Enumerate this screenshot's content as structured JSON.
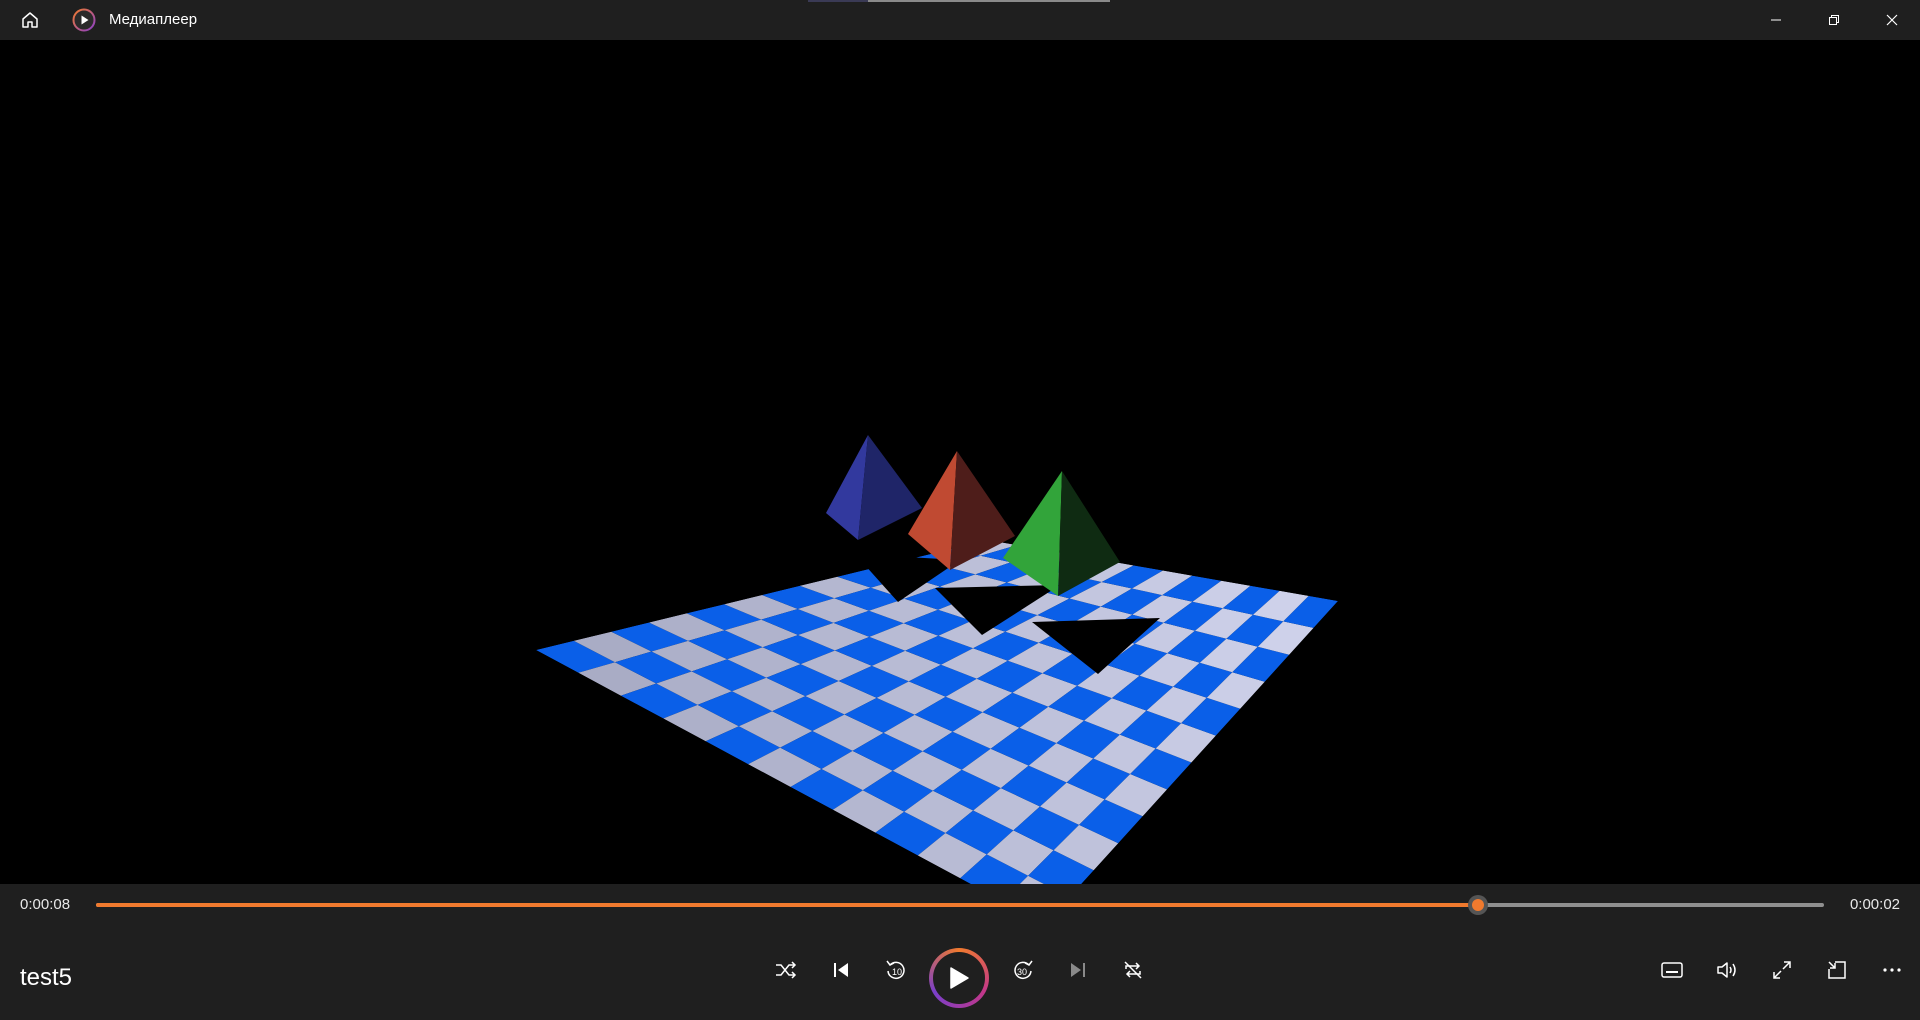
{
  "window": {
    "app_title": "Медиаплеер",
    "icons": {
      "home": "home-icon",
      "logo": "media-player-logo-icon",
      "minimize": "minimize-icon",
      "restore": "restore-icon",
      "close": "close-icon"
    }
  },
  "player": {
    "title": "test5",
    "time_elapsed": "0:00:08",
    "time_remaining": "0:00:02",
    "progress_fraction": 0.8,
    "accent_color": "#f07a2e"
  },
  "controls": {
    "center": [
      "shuffle-icon",
      "previous-icon",
      "skip-back-10-icon",
      "play-icon",
      "skip-forward-30-icon",
      "next-icon",
      "repeat-icon"
    ],
    "skip_back_label": "10",
    "skip_forward_label": "30",
    "right": [
      "subtitles-icon",
      "volume-icon",
      "full-screen-icon",
      "mini-player-icon",
      "more-options-icon"
    ]
  }
}
